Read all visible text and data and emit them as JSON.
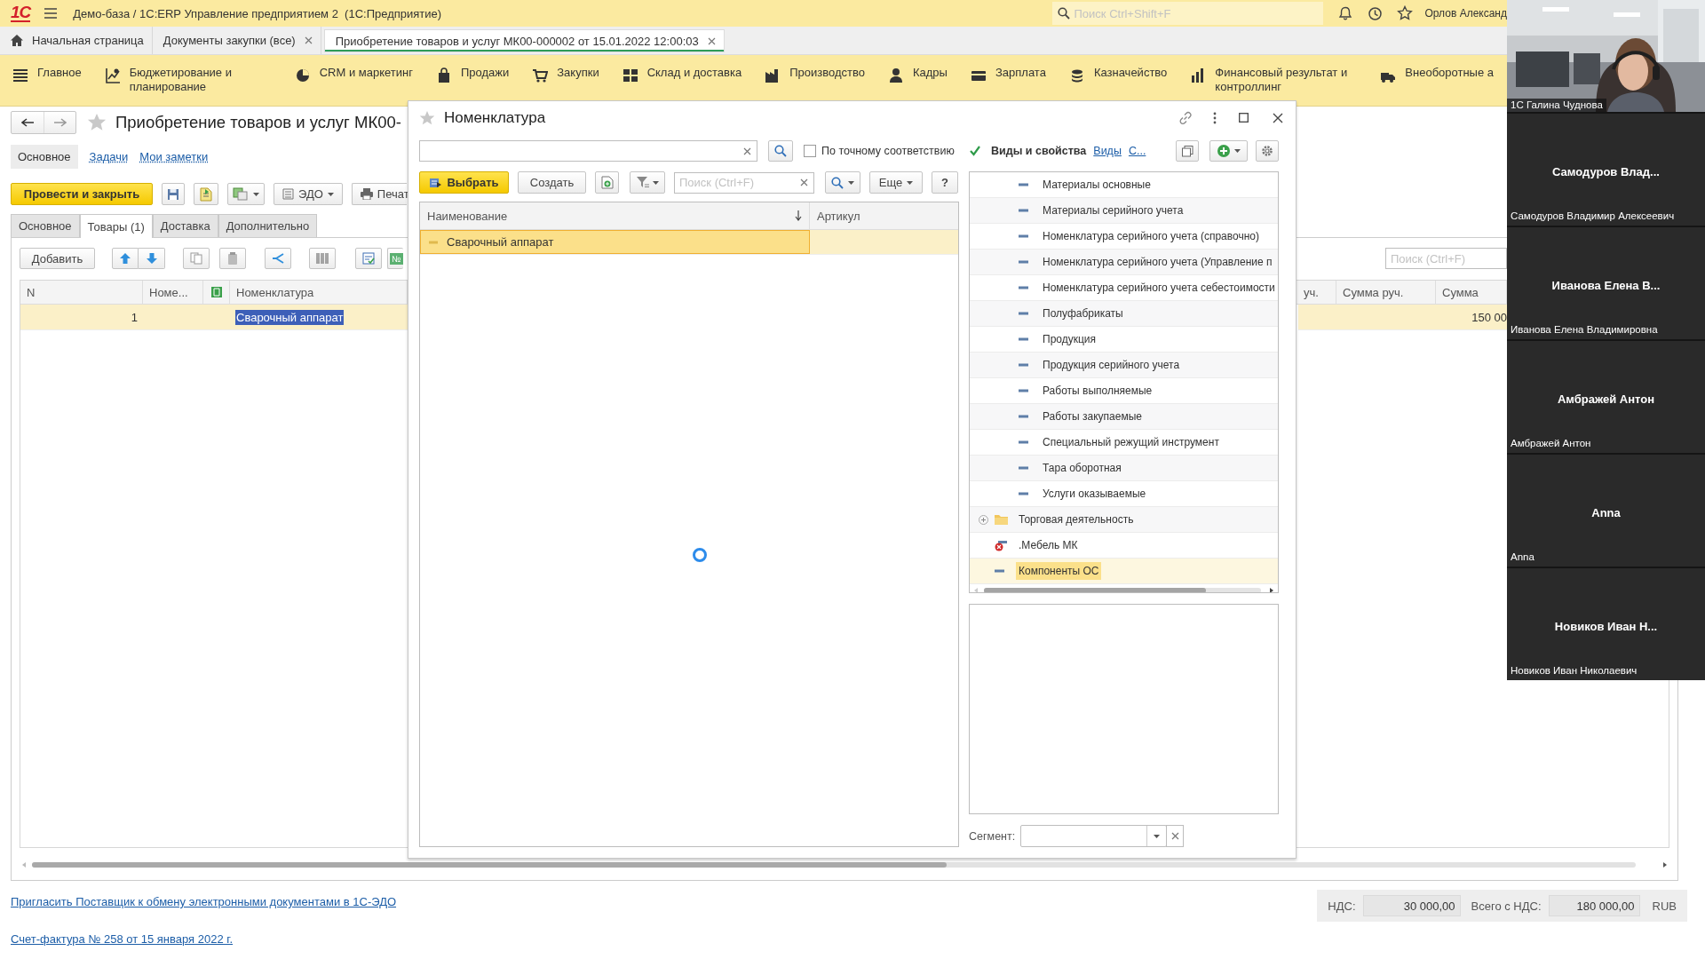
{
  "app_bar": {
    "logo": "1С",
    "title": "Демо-база / 1С:ERP Управление предприятием 2  (1С:Предприятие)",
    "search": {
      "placeholder": "Поиск Ctrl+Shift+F"
    },
    "user": "Орлов Александ"
  },
  "open_tabs": [
    {
      "label": "Начальная страница",
      "kind": "home",
      "selected": false
    },
    {
      "label": "Документы закупки (все)",
      "kind": "closable",
      "selected": false
    },
    {
      "label": "Приобретение товаров и услуг МК00-000002 от 15.01.2022 12:00:03",
      "kind": "closable",
      "selected": true
    }
  ],
  "sections": [
    "Главное",
    "Бюджетирование и планирование",
    "CRM и маркетинг",
    "Продажи",
    "Закупки",
    "Склад и доставка",
    "Производство",
    "Кадры",
    "Зарплата",
    "Казначейство",
    "Финансовый результат и контроллинг",
    "Внеоборотные а"
  ],
  "document": {
    "title": "Приобретение товаров и услуг МК00-",
    "nav_links": [
      {
        "label": "Основное",
        "selected": true
      },
      {
        "label": "Задачи",
        "selected": false
      },
      {
        "label": "Мои заметки",
        "selected": false
      }
    ],
    "post_button": "Провести и закрыть",
    "edo_button": "ЭДО",
    "print_button": "Печат",
    "tabs": [
      {
        "label": "Основное",
        "selected": false
      },
      {
        "label": "Товары (1)",
        "selected": true
      },
      {
        "label": "Доставка",
        "selected": false
      },
      {
        "label": "Дополнительно",
        "selected": false
      }
    ],
    "add_button": "Добавить",
    "numbering_button": "№",
    "search": {
      "placeholder": "Поиск (Ctrl+F)"
    },
    "table": {
      "columns": [
        {
          "kind": "text",
          "label": "N"
        },
        {
          "kind": "text",
          "label": "Номе..."
        },
        {
          "kind": "icon"
        },
        {
          "kind": "text",
          "label": "Номенклатура"
        },
        {
          "kind": "text",
          "label": "уч."
        },
        {
          "kind": "text",
          "label": "Сумма руч."
        },
        {
          "kind": "text",
          "label": "Сумма"
        }
      ],
      "rows": [
        {
          "n": "1",
          "nomenclature": "Сварочный аппарат",
          "sum": "150 00",
          "selected": true
        }
      ]
    },
    "edo_invite_link": "Пригласить Поставщик к обмену электронными документами в 1С-ЭДО",
    "invoice_link": "Счет-фактура № 258 от 15 января 2022 г.",
    "totals": [
      {
        "label": "НДС:",
        "value": "30 000,00"
      },
      {
        "label": "Всего с НДС:",
        "value": "180 000,00"
      }
    ],
    "currency": "RUB"
  },
  "dialog": {
    "title": "Номенклатура",
    "exact_match": {
      "label": "По точному соответствию",
      "checked": false
    },
    "kinds_filter": {
      "label": "Виды и свойства",
      "checked": true
    },
    "kinds_links": [
      "Виды",
      "С..."
    ],
    "select_button": "Выбрать",
    "create_button": "Создать",
    "list_search": {
      "placeholder": "Поиск (Ctrl+F)"
    },
    "more_button": "Еще",
    "help_button": "?",
    "list": {
      "columns": [
        "Наименование",
        "Артикул"
      ],
      "rows": [
        {
          "name": "Сварочный аппарат",
          "selected": true
        }
      ],
      "loading": true
    },
    "tree": [
      {
        "children": [
          {
            "label": "Материалы основные",
            "kind": "item",
            "selected": false
          },
          {
            "label": "Материалы серийного учета",
            "kind": "item",
            "selected": false
          },
          {
            "label": "Номенклатура серийного учета (справочно)",
            "kind": "item",
            "selected": false
          },
          {
            "label": "Номенклатура серийного учета (Управление п",
            "kind": "item",
            "selected": false
          },
          {
            "label": "Номенклатура серийного учета себестоимости",
            "kind": "item",
            "selected": false
          },
          {
            "label": "Полуфабрикаты",
            "kind": "item",
            "selected": false
          },
          {
            "label": "Продукция",
            "kind": "item",
            "selected": false
          },
          {
            "label": "Продукция серийного учета",
            "kind": "item",
            "selected": false
          },
          {
            "label": "Работы выполняемые",
            "kind": "item",
            "selected": false
          },
          {
            "label": "Работы закупаемые",
            "kind": "item",
            "selected": false
          },
          {
            "label": "Специальный режущий инструмент",
            "kind": "item",
            "selected": false
          },
          {
            "label": "Тара оборотная",
            "kind": "item",
            "selected": false
          },
          {
            "label": "Услуги оказываемые",
            "kind": "item",
            "selected": false
          }
        ]
      },
      {
        "label": "Торговая деятельность",
        "kind": "group",
        "expanded": false,
        "selected": false
      },
      {
        "label": ".Мебель МК",
        "kind": "deleted",
        "selected": false
      },
      {
        "label": "Компоненты ОС",
        "kind": "item",
        "selected": true
      }
    ],
    "segment": {
      "label": "Сегмент:"
    }
  },
  "participants": [
    {
      "kind": "video",
      "name": "1С Галина Чуднова"
    },
    {
      "kind": "avatar",
      "short_name": "Самодуров Влад...",
      "name": "Самодуров Владимир Алексеевич"
    },
    {
      "kind": "avatar",
      "short_name": "Иванова Елена В...",
      "name": "Иванова Елена Владимировна"
    },
    {
      "kind": "avatar",
      "short_name": "Амбражей Антон",
      "name": "Амбражей Антон"
    },
    {
      "kind": "avatar",
      "short_name": "Anna",
      "name": "Anna"
    },
    {
      "kind": "avatar",
      "short_name": "Новиков Иван Н...",
      "name": "Новиков Иван Николаевич"
    }
  ]
}
